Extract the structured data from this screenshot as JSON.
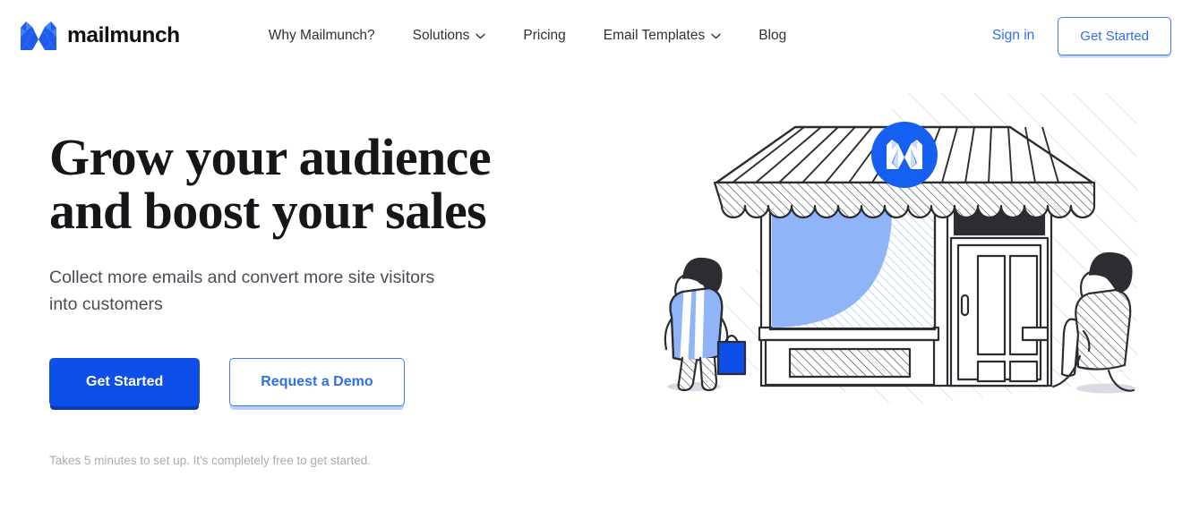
{
  "brand": {
    "name": "mailmunch",
    "logo_icon": "mailmunch-m-logo-icon",
    "accent_blue": "#0d4fe8",
    "link_blue": "#2f6ef0"
  },
  "header": {
    "nav": [
      {
        "label": "Why Mailmunch?",
        "has_dropdown": false
      },
      {
        "label": "Solutions",
        "has_dropdown": true,
        "icon": "chevron-down-icon"
      },
      {
        "label": "Pricing",
        "has_dropdown": false
      },
      {
        "label": "Email Templates",
        "has_dropdown": true,
        "icon": "chevron-down-icon"
      },
      {
        "label": "Blog",
        "has_dropdown": false
      }
    ],
    "sign_in_label": "Sign in",
    "get_started_label": "Get Started"
  },
  "hero": {
    "title": "Grow your audience\nand boost your sales",
    "subtitle": "Collect more emails and convert more site visitors\ninto customers",
    "primary_cta": "Get Started",
    "secondary_cta": "Request a Demo",
    "note": "Takes 5 minutes to set up. It's completely free to get started.",
    "illustration": {
      "name": "storefront-illustration",
      "badge_icon": "mailmunch-circle-badge-icon",
      "elements": [
        "striped-awning",
        "shop-window",
        "shop-door",
        "shopper-with-bag",
        "pedestrian"
      ]
    }
  }
}
